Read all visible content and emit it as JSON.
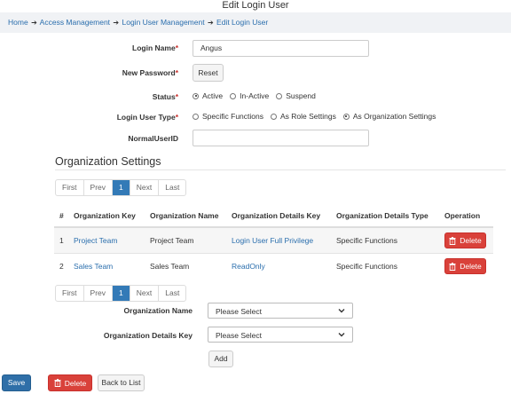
{
  "page_title": "Edit Login User",
  "breadcrumb": [
    "Home",
    "Access Management",
    "Login User Management",
    "Edit Login User"
  ],
  "form": {
    "login_name_label": "Login Name",
    "login_name_value": "Angus",
    "new_password_label": "New Password",
    "reset_label": "Reset",
    "status_label": "Status",
    "status_options": [
      "Active",
      "In-Active",
      "Suspend"
    ],
    "status_selected": "Active",
    "login_user_type_label": "Login User Type",
    "login_user_type_options": [
      "Specific Functions",
      "As Role Settings",
      "As Organization Settings"
    ],
    "login_user_type_selected": "As Organization Settings",
    "normal_user_id_label": "NormalUserID",
    "normal_user_id_value": ""
  },
  "org_settings": {
    "title": "Organization Settings",
    "pager": [
      "First",
      "Prev",
      "1",
      "Next",
      "Last"
    ],
    "columns": [
      "#",
      "Organization Key",
      "Organization Name",
      "Organization Details Key",
      "Organization Details Type",
      "Operation"
    ],
    "rows": [
      {
        "num": "1",
        "org_key": "Project Team",
        "org_name": "Project Team",
        "details_key": "Login User Full Privilege",
        "details_type": "Specific Functions",
        "op": "Delete"
      },
      {
        "num": "2",
        "org_key": "Sales Team",
        "org_name": "Sales Team",
        "details_key": "ReadOnly",
        "details_type": "Specific Functions",
        "op": "Delete"
      }
    ],
    "org_name_label": "Organization Name",
    "org_name_value": "Please Select",
    "org_details_key_label": "Organization Details Key",
    "org_details_key_value": "Please Select",
    "add_label": "Add"
  },
  "footer": {
    "save_label": "Save",
    "delete_label": "Delete",
    "back_label": "Back to List"
  },
  "colors": {
    "primary": "#2f6fa8",
    "danger": "#d9413a",
    "link": "#2a6ead",
    "breadcrumb_bg": "#f0f2f5"
  }
}
